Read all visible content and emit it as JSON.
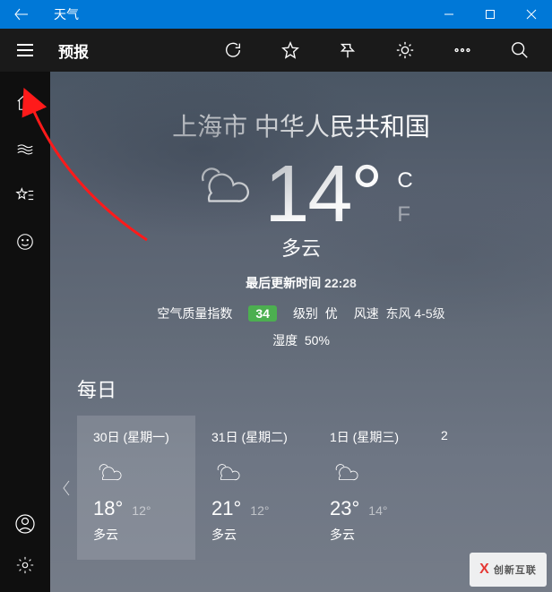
{
  "app": {
    "title": "天气"
  },
  "toolbar": {
    "label": "预报"
  },
  "sidebar": {
    "items": [
      "home",
      "maps",
      "favorites",
      "feedback"
    ],
    "bottom": [
      "account",
      "settings"
    ]
  },
  "current": {
    "location": "上海市 中华人民共和国",
    "temp": "14",
    "degree": "°",
    "unit_c": "C",
    "unit_f": "F",
    "condition": "多云",
    "updated_label": "最后更新时间",
    "updated_time": "22:28",
    "aqi_label": "空气质量指数",
    "aqi_value": "34",
    "aqi_level_label": "级别",
    "aqi_level": "优",
    "wind_label": "风速",
    "wind_value": "东风 4-5级",
    "humidity_label": "湿度",
    "humidity_value": "50%"
  },
  "daily": {
    "heading": "每日",
    "days": [
      {
        "date": "30日 (星期一)",
        "hi": "18°",
        "lo": "12°",
        "cond": "多云",
        "selected": true
      },
      {
        "date": "31日 (星期二)",
        "hi": "21°",
        "lo": "12°",
        "cond": "多云",
        "selected": false
      },
      {
        "date": "1日 (星期三)",
        "hi": "23°",
        "lo": "14°",
        "cond": "多云",
        "selected": false
      },
      {
        "date": "2",
        "hi": "",
        "lo": "",
        "cond": "",
        "selected": false
      }
    ]
  },
  "watermark": "创新互联"
}
